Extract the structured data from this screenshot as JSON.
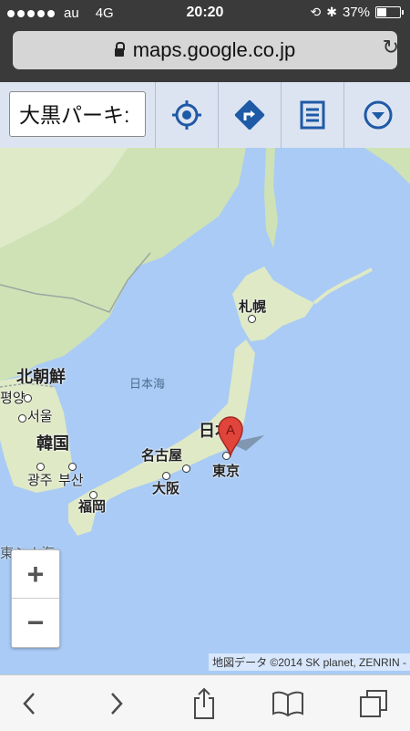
{
  "status_bar": {
    "carrier": "au",
    "network": "4G",
    "time": "20:20",
    "battery": "37%",
    "battery_level": 0.37
  },
  "browser": {
    "url": "maps.google.co.jp"
  },
  "toolbar": {
    "search_value": "大黒パーキ:"
  },
  "map": {
    "labels": {
      "north_korea": "北朝鮮",
      "korea": "韓国",
      "japan": "日本",
      "sea_of_japan": "日本海",
      "sapporo": "札幌",
      "tokyo": "東京",
      "nagoya": "名古屋",
      "osaka": "大阪",
      "fukuoka": "福岡",
      "seoul": "서울",
      "pyongyang": "평양",
      "gwangju": "광주",
      "busan": "부산",
      "east_china_sea": "東シナ海"
    },
    "marker_label": "A",
    "attribution": "地図データ ©2014 SK planet, ZENRIN -",
    "colors": {
      "water": "#a9cbf5",
      "land": "#e8efd8",
      "forest": "#cfe2b5",
      "marker": "#e0443b"
    }
  },
  "zoom": {
    "in": "+",
    "out": "−"
  }
}
